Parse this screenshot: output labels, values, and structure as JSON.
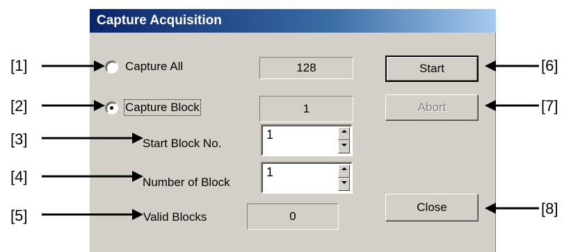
{
  "dialog": {
    "title": "Capture Acquisition"
  },
  "options": {
    "capture_all_label": "Capture All",
    "capture_all_value": "128",
    "capture_block_label": "Capture Block",
    "capture_block_value": "1"
  },
  "fields": {
    "start_block_label": "Start Block No.",
    "start_block_value": "1",
    "number_of_block_label": "Number of Block",
    "number_of_block_value": "1",
    "valid_blocks_label": "Valid Blocks",
    "valid_blocks_value": "0"
  },
  "buttons": {
    "start": "Start",
    "abort": "Abort",
    "close": "Close"
  },
  "callouts": [
    "[1]",
    "[2]",
    "[3]",
    "[4]",
    "[5]",
    "[6]",
    "[7]",
    "[8]"
  ]
}
